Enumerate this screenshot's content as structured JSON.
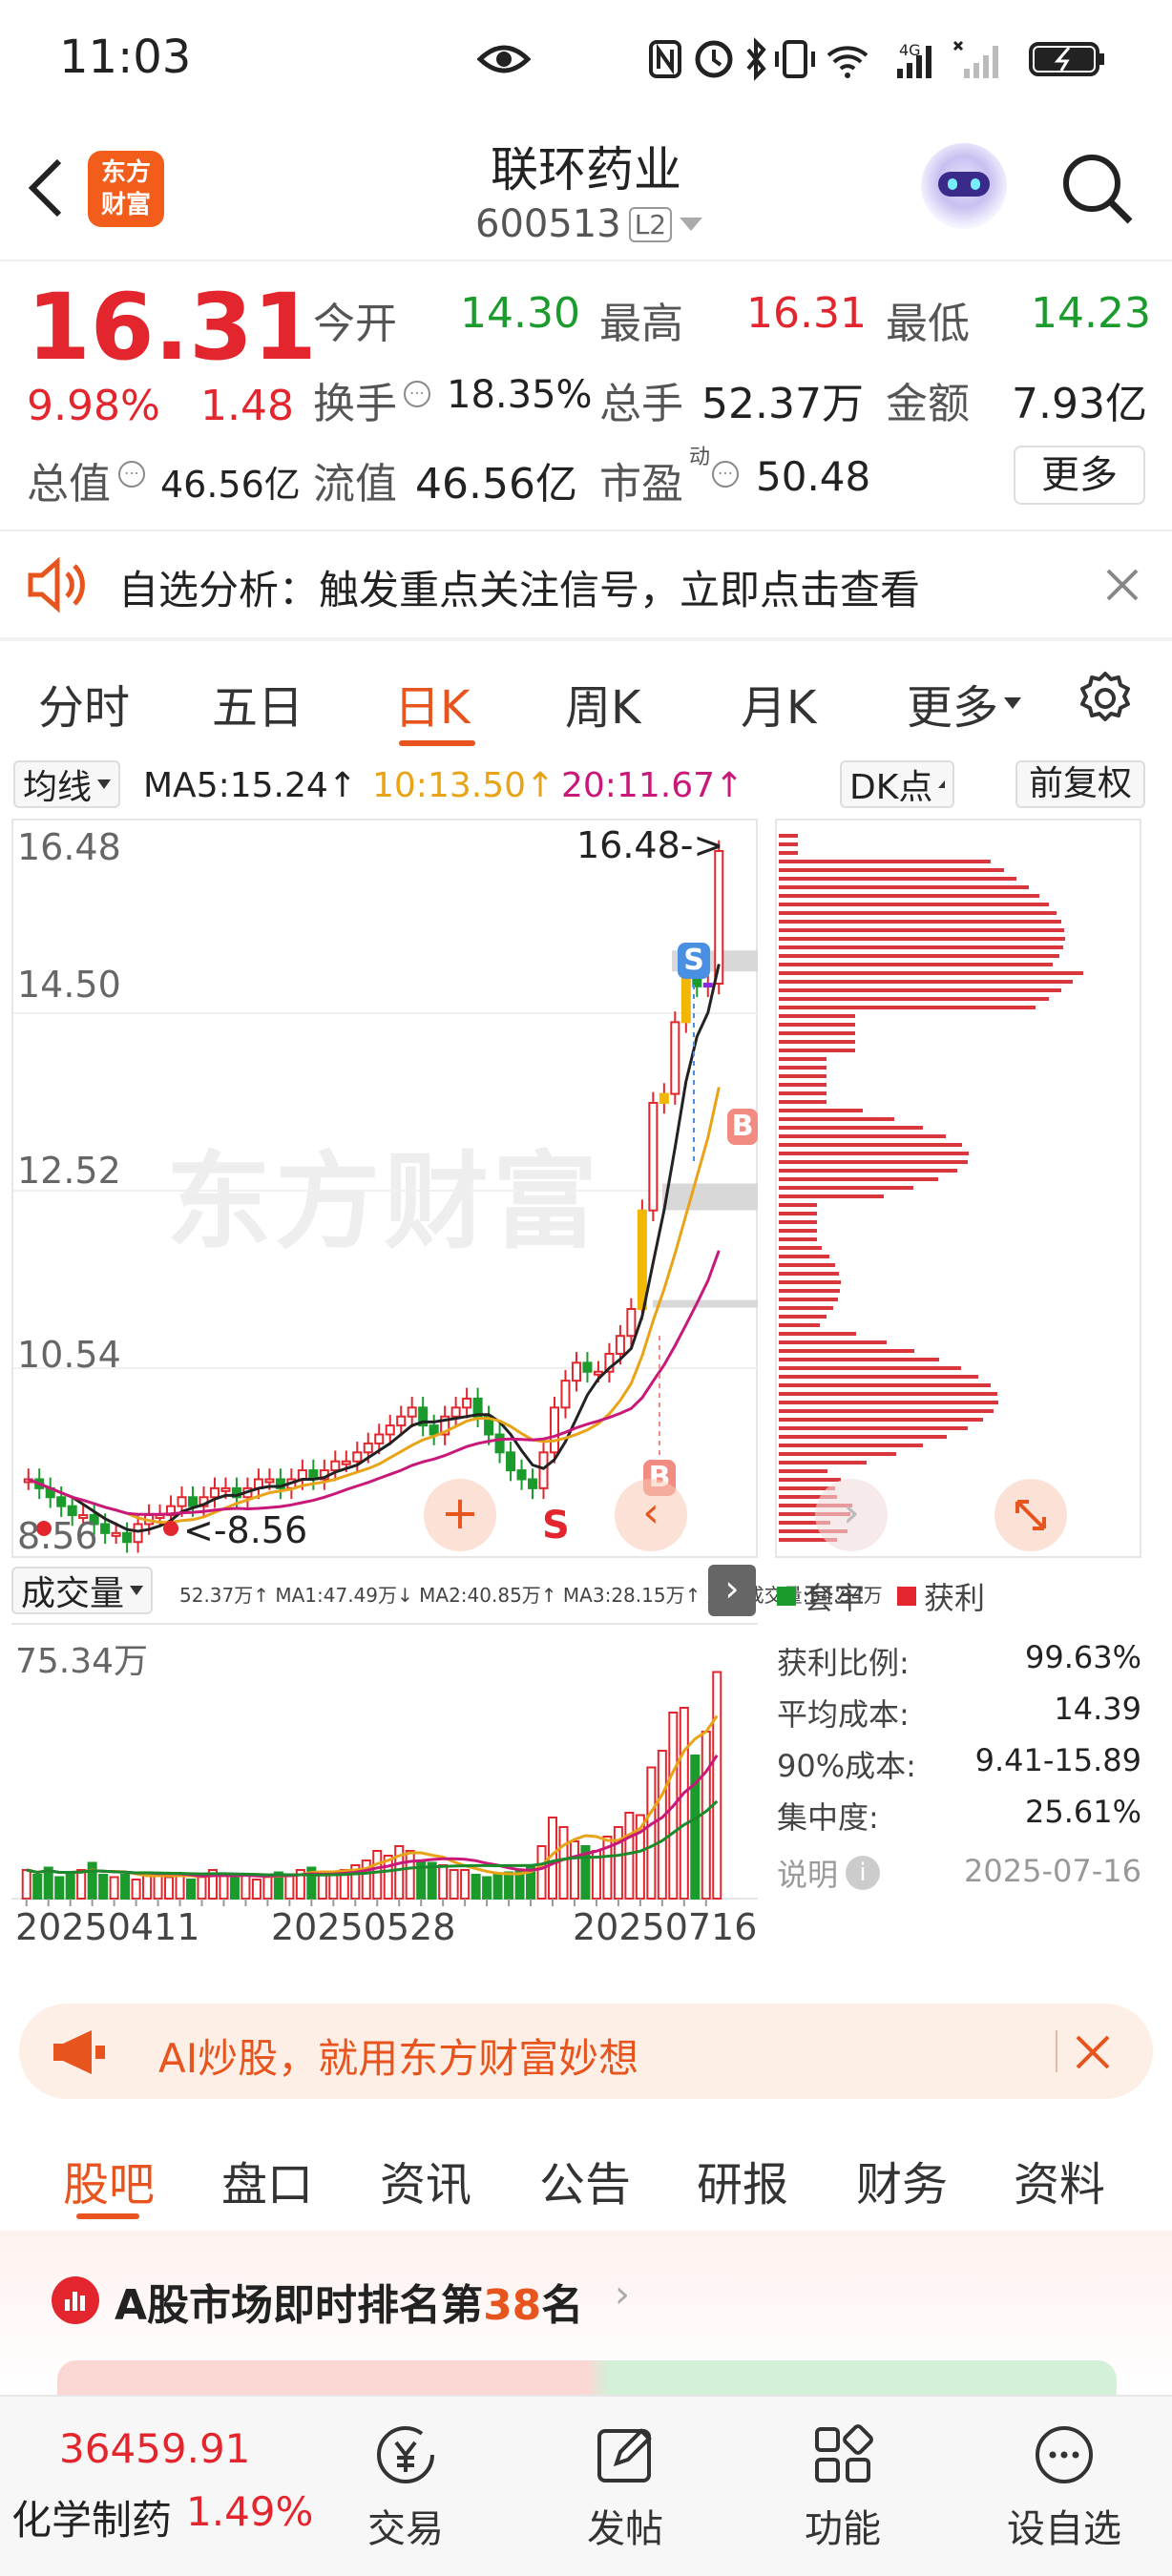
{
  "status_bar": {
    "time": "11:03"
  },
  "header": {
    "title": "联环药业",
    "code": "600513",
    "level": "L2",
    "logo_line1": "东方",
    "logo_line2": "财富"
  },
  "quote": {
    "price": "16.31",
    "change_pct": "9.98%",
    "change": "1.48",
    "open_label": "今开",
    "open": "14.30",
    "high_label": "最高",
    "high": "16.31",
    "low_label": "最低",
    "low": "14.23",
    "turnover_label": "换手",
    "turnover": "18.35%",
    "volume_label": "总手",
    "volume": "52.37万",
    "amount_label": "金额",
    "amount": "7.93亿",
    "mcap_label": "总值",
    "mcap": "46.56亿",
    "float_label": "流值",
    "float": "46.56亿",
    "pe_label": "市盈",
    "pe_sup": "动",
    "pe": "50.48",
    "more_btn": "更多"
  },
  "notice": {
    "text": "自选分析：触发重点关注信号，立即点击查看"
  },
  "chart_tabs": [
    "分时",
    "五日",
    "日K",
    "周K",
    "月K",
    "更多"
  ],
  "active_tab": 2,
  "indicator": {
    "ma_select": "均线",
    "ma5": "MA5:15.24",
    "ma10": "10:13.50",
    "ma20": "20:11.67",
    "dk_select": "DK点",
    "adjust_btn": "前复权",
    "watermark": "东方财富",
    "y_labels": [
      "16.48",
      "14.50",
      "12.52",
      "10.54",
      "8.56"
    ],
    "high_mark": "16.48->",
    "low_mark": "<-8.56",
    "signal_s": "S",
    "signal_b": "B"
  },
  "colors": {
    "up": "#e3262d",
    "down": "#1a9b2c",
    "accent": "#e8541d",
    "ma5": "#222222",
    "ma10": "#e8a317",
    "ma20": "#c8197a"
  },
  "chip": {
    "legend_trapped": "套牢",
    "legend_profit": "获利",
    "stats": [
      {
        "label": "获利比例:",
        "value": "99.63%"
      },
      {
        "label": "平均成本:",
        "value": "14.39"
      },
      {
        "label": "90%成本:",
        "value": "9.41-15.89"
      },
      {
        "label": "集中度:",
        "value": "25.61%"
      }
    ],
    "note_label": "说明",
    "date": "2025-07-16"
  },
  "volume": {
    "select": "成交量",
    "line": "52.37万↑ MA1:47.49万↓ MA2:40.85万↑ MA3:28.15万↑ 虚拟成交量:54.34万",
    "max_label": "75.34万",
    "dates": [
      "20250411",
      "20250528",
      "20250716"
    ]
  },
  "ad_banner": {
    "text": "AI炒股，就用东方财富妙想"
  },
  "bottom_tabs": [
    "股吧",
    "盘口",
    "资讯",
    "公告",
    "研报",
    "财务",
    "资料"
  ],
  "ranking": {
    "prefix": "A股市场即时排名第",
    "rank": "38",
    "suffix": "名"
  },
  "nav": {
    "index_value": "36459.91",
    "sector": "化学制药",
    "sector_pct": "1.49%",
    "items": [
      {
        "label": "交易",
        "icon": "yen-icon"
      },
      {
        "label": "发帖",
        "icon": "edit-icon"
      },
      {
        "label": "功能",
        "icon": "grid-icon"
      },
      {
        "label": "设自选",
        "icon": "more-icon"
      }
    ]
  }
}
